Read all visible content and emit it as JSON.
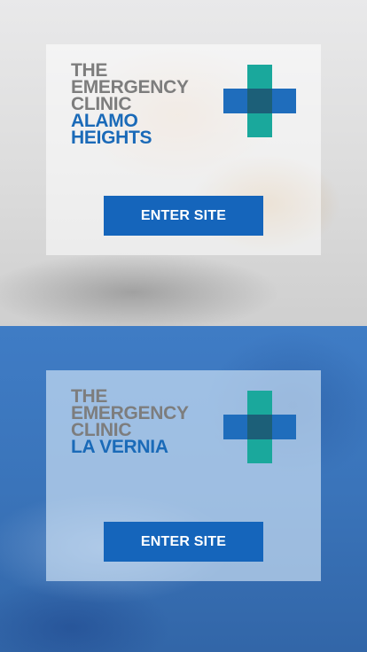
{
  "clinics": [
    {
      "line1": "THE",
      "line2": "EMERGENCY",
      "line3": "CLINIC",
      "location_line1": "ALAMO",
      "location_line2": "HEIGHTS",
      "button_label": "ENTER SITE"
    },
    {
      "line1": "THE",
      "line2": "EMERGENCY",
      "line3": "CLINIC",
      "location_line1": "LA VERNIA",
      "location_line2": "",
      "button_label": "ENTER SITE"
    }
  ],
  "colors": {
    "brand_grey": "#7d7d7d",
    "brand_blue": "#1a6ab8",
    "cross_teal": "#1aa89c",
    "cross_blue": "#1f6dbc",
    "button_blue": "#1565bb"
  },
  "icons": {
    "logo_mark": "medical-cross-icon"
  }
}
